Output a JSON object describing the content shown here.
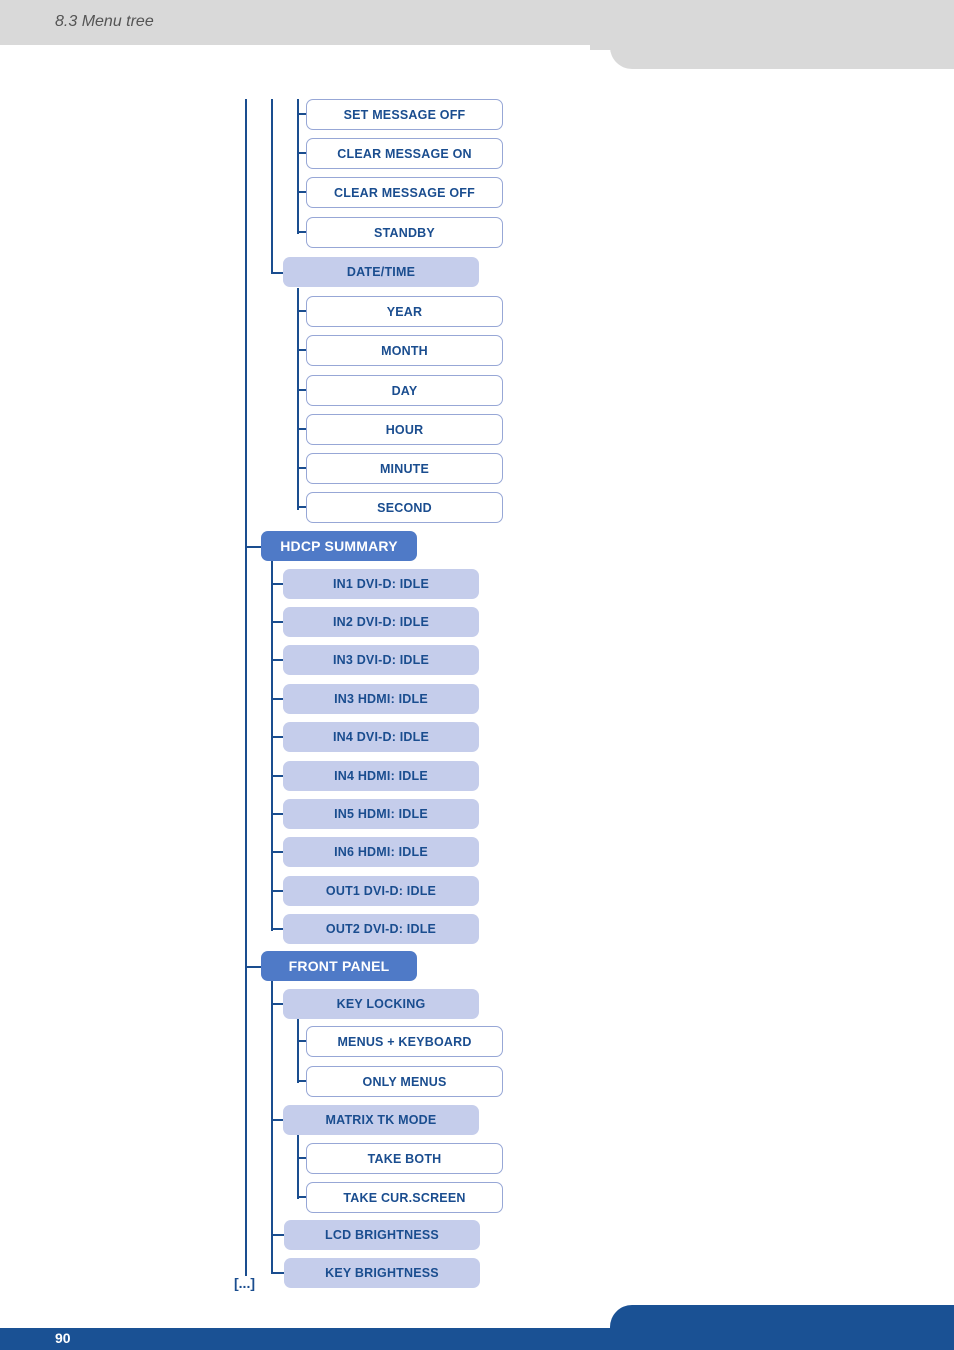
{
  "header": {
    "section_title": "8.3 Menu tree"
  },
  "footer": {
    "page_number": "90"
  },
  "tree": {
    "continuation": "[...]",
    "top_leaves": [
      "SET MESSAGE OFF",
      "CLEAR MESSAGE ON",
      "CLEAR MESSAGE OFF",
      "STANDBY"
    ],
    "date_time": {
      "label": "DATE/TIME",
      "children": [
        "YEAR",
        "MONTH",
        "DAY",
        "HOUR",
        "MINUTE",
        "SECOND"
      ]
    },
    "hdcp_summary": {
      "label": "HDCP SUMMARY",
      "children": [
        "IN1 DVI-D: IDLE",
        "IN2 DVI-D: IDLE",
        "IN3 DVI-D: IDLE",
        "IN3 HDMI: IDLE",
        "IN4 DVI-D: IDLE",
        "IN4 HDMI: IDLE",
        "IN5 HDMI: IDLE",
        "IN6 HDMI: IDLE",
        "OUT1 DVI-D: IDLE",
        "OUT2 DVI-D: IDLE"
      ]
    },
    "front_panel": {
      "label": "FRONT PANEL",
      "key_locking": {
        "label": "KEY LOCKING",
        "children": [
          "MENUS + KEYBOARD",
          "ONLY MENUS"
        ]
      },
      "matrix_tk_mode": {
        "label": "MATRIX TK MODE",
        "children": [
          "TAKE BOTH",
          "TAKE CUR.SCREEN"
        ]
      },
      "lcd_brightness": "LCD BRIGHTNESS",
      "key_brightness": "KEY BRIGHTNESS"
    }
  }
}
